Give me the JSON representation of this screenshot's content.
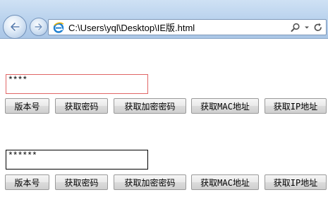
{
  "browser": {
    "address": "C:\\Users\\yql\\Desktop\\IE版.html"
  },
  "groups": [
    {
      "field_value": "****",
      "border_color": "#e06666",
      "buttons": [
        "版本号",
        "获取密码",
        "获取加密密码",
        "获取MAC地址",
        "获取IP地址"
      ]
    },
    {
      "field_value": "******",
      "border_color": "#000000",
      "buttons": [
        "版本号",
        "获取密码",
        "获取加密密码",
        "获取MAC地址",
        "获取IP地址"
      ]
    }
  ]
}
